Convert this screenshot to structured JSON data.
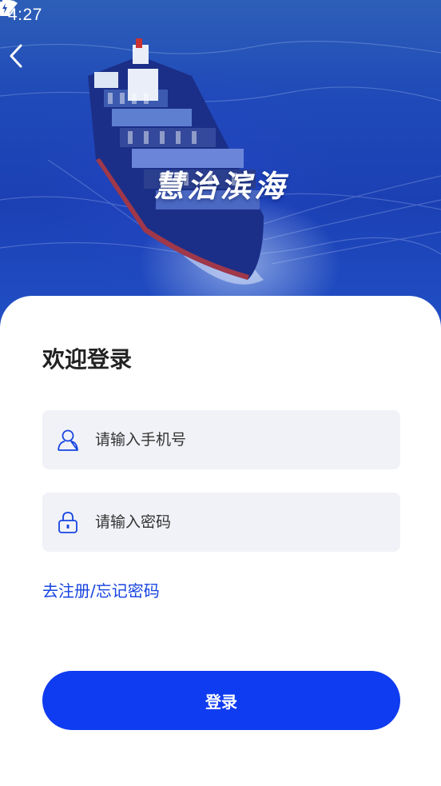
{
  "status_bar": {
    "time": "4:27",
    "icons": [
      "wifi-icon",
      "cell-signal-icon",
      "battery-charging-icon"
    ]
  },
  "header": {
    "back_icon": "chevron-left-icon",
    "brand_title": "慧治滨海"
  },
  "login": {
    "welcome_title": "欢迎登录",
    "phone": {
      "icon": "user-icon",
      "value": "",
      "placeholder": "请输入手机号"
    },
    "password": {
      "icon": "lock-icon",
      "value": "",
      "placeholder": "请输入密码"
    },
    "register_link": "去注册/",
    "forgot_link": " 忘记密码",
    "submit_label": "登录"
  },
  "colors": {
    "accent": "#0f3cf0",
    "link": "#1644e0",
    "input_bg": "#f1f2f7",
    "hero_blue": "#1f49b8"
  }
}
